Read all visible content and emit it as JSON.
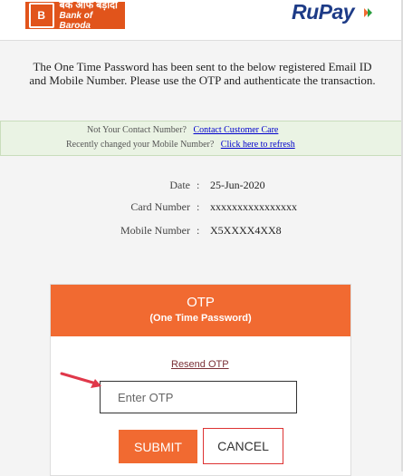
{
  "header": {
    "bank_name_hindi": "बैंक ऑफ बड़ौदा",
    "bank_name": "Bank of Baroda",
    "rupay_logo": "RuPay",
    "rupay_accent_color": "#f16a31"
  },
  "message": "The One Time Password has been sent to the below registered Email ID and Mobile Number. Please use the OTP and authenticate the transaction.",
  "notice": {
    "contact_prompt": "Not Your Contact Number?",
    "contact_link": "Contact Customer Care",
    "mobile_prompt": "Recently changed your Mobile Number?",
    "refresh_link": "Click here to refresh"
  },
  "details": {
    "date_label": "Date",
    "date_value": "25-Jun-2020",
    "card_label": "Card Number",
    "card_value": "xxxxxxxxxxxxxxxx",
    "mobile_label": "Mobile Number",
    "mobile_value": "X5XXXX4XX8",
    "separator": ":"
  },
  "otp": {
    "title": "OTP",
    "subtitle": "(One Time Password)",
    "resend_label": "Resend OTP",
    "input_placeholder": "Enter OTP",
    "submit_label": "SUBMIT",
    "cancel_label": "CANCEL",
    "brand_color": "#f16a31",
    "arrow_color": "#e0384a"
  }
}
